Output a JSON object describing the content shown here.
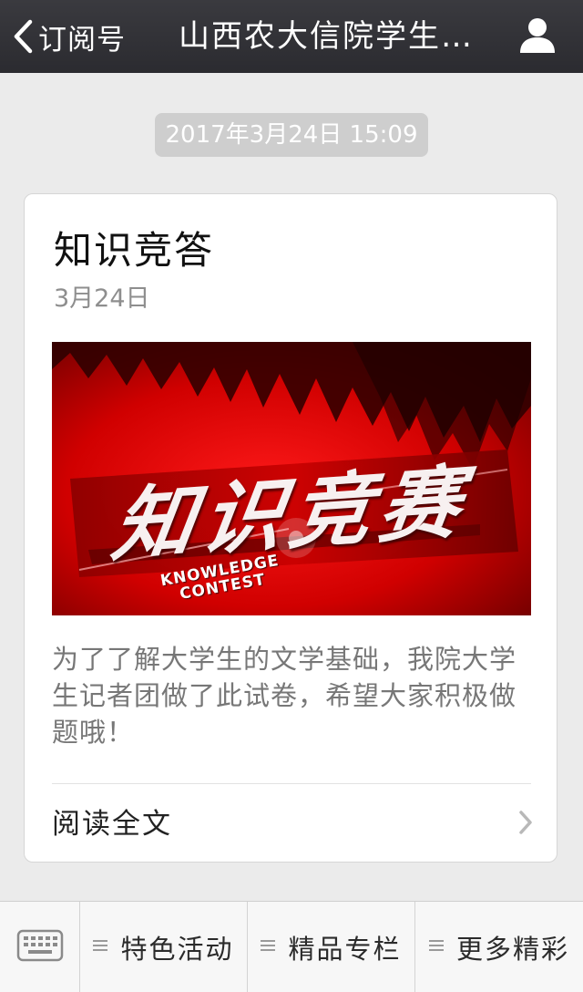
{
  "header": {
    "back_label": "订阅号",
    "title": "山西农大信院学生…"
  },
  "message": {
    "timestamp": "2017年3月24日 15:09",
    "card": {
      "title": "知识竞答",
      "date": "3月24日",
      "cover": {
        "headline": "知识竞赛",
        "sub_line1": "KNOWLEDGE",
        "sub_line2": "CONTEST"
      },
      "description": "为了了解大学生的文学基础，我院大学生记者团做了此试卷，希望大家积极做题哦！",
      "read_more": "阅读全文"
    }
  },
  "bottom_menu": {
    "items": [
      {
        "label": "特色活动"
      },
      {
        "label": "精品专栏"
      },
      {
        "label": "更多精彩"
      }
    ]
  },
  "colors": {
    "header_bg": "#2f2f34",
    "page_bg": "#ebebeb",
    "chip_bg": "#cecece",
    "cover_red": "#c40000"
  },
  "icons": [
    "chevron-left-icon",
    "person-icon",
    "keyboard-icon",
    "menu-lines-icon",
    "chevron-right-icon"
  ]
}
